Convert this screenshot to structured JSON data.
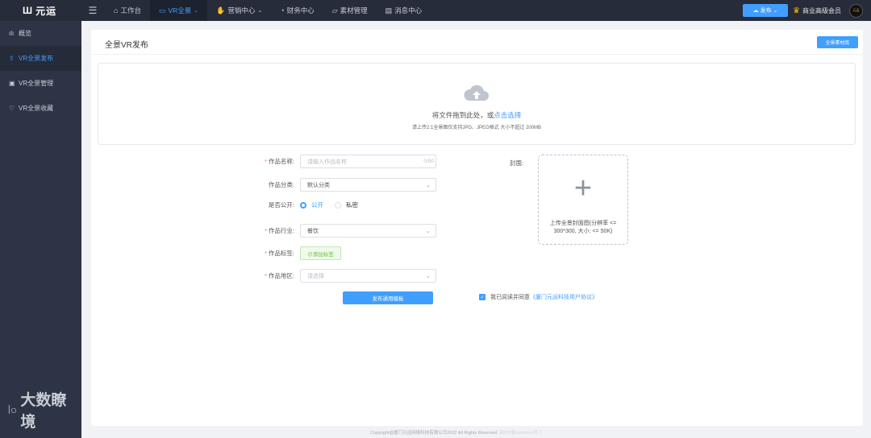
{
  "brand": {
    "logo_text": "元运",
    "logo_icon": "logo-mark-icon"
  },
  "topnav": {
    "menu_icon": "hamburger-icon",
    "items": [
      {
        "label": "工作台",
        "icon": "home-icon",
        "dropdown": false
      },
      {
        "label": "VR全景",
        "icon": "vr-icon",
        "dropdown": true,
        "active": true
      },
      {
        "label": "营销中心",
        "icon": "marketing-icon",
        "dropdown": true
      },
      {
        "label": "财务中心",
        "icon": "finance-icon",
        "dropdown": false
      },
      {
        "label": "素材管理",
        "icon": "folder-icon",
        "dropdown": false
      },
      {
        "label": "消息中心",
        "icon": "message-icon",
        "dropdown": false
      }
    ],
    "publish_label": "发布",
    "vip_label": "商业高级会员",
    "avatar_text": "元运"
  },
  "sidebar": {
    "items": [
      {
        "label": "概览",
        "icon": "chart-icon"
      },
      {
        "label": "VR全景发布",
        "icon": "upload-icon",
        "active": true
      },
      {
        "label": "VR全景管理",
        "icon": "manage-icon"
      },
      {
        "label": "VR全景收藏",
        "icon": "heart-icon"
      }
    ]
  },
  "page": {
    "title": "全景VR发布",
    "material_button": "全景素材库"
  },
  "upload": {
    "drop_text": "将文件拖到此处，或",
    "drop_link": "点击选择",
    "hint": "请上传2:1全景图仅支持JPG、JPEG格式 大小不超过 200MB"
  },
  "form": {
    "name_label": "作品名称",
    "name_placeholder": "请输入作品名称",
    "name_count": "0/50",
    "category_label": "作品分类",
    "category_value": "默认分类",
    "public_label": "是否公开",
    "public_option": "公开",
    "private_option": "私密",
    "industry_label": "作品行业",
    "industry_value": "餐饮",
    "tags_label": "作品标签",
    "tags_button": "⊘添加标签",
    "region_label": "作品地区",
    "region_placeholder": "请选择",
    "submit_label": "发布通用模板"
  },
  "cover": {
    "label": "封面",
    "hint": "上传全景封面图(分辨率 <= 300*300, 大小: <= 50K)"
  },
  "agreement": {
    "text": "我已阅读并同意",
    "link": "《厦门元运科技用户协议》",
    "checked": true
  },
  "footer": {
    "copyright": "Copyright@厦门元运网络科技有限公司2022 All Rights Reserved",
    "icp": "闽ICP备xxxxxxxx号-1"
  },
  "watermark": {
    "text": "大数瞭境"
  },
  "colors": {
    "accent": "#409eff",
    "topbar": "#262c3a",
    "sidebar": "#2d3445",
    "tag_green": "#67c23a",
    "required": "#f56c6c"
  }
}
